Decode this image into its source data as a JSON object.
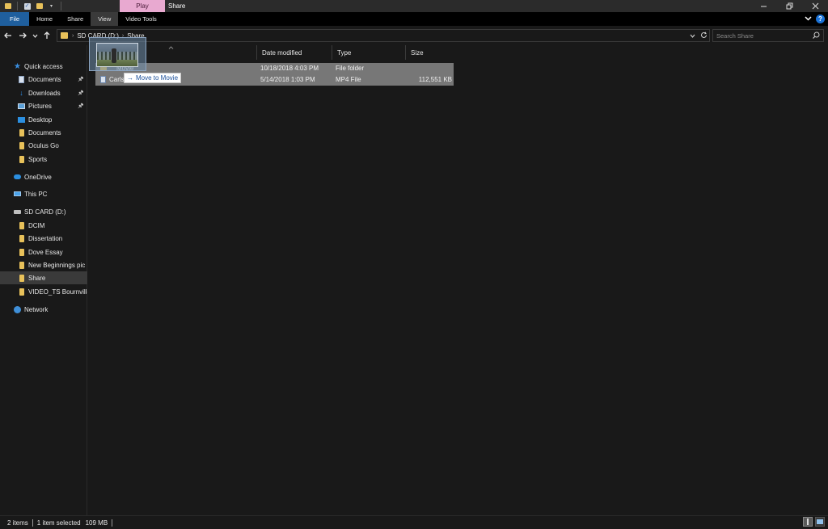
{
  "titlebar": {
    "contextual_tab": "Play",
    "title": "Share",
    "controls": [
      "minimize",
      "restore",
      "close"
    ]
  },
  "ribbon": {
    "tabs": [
      "File",
      "Home",
      "Share",
      "View",
      "Video Tools"
    ]
  },
  "address": {
    "crumbs": [
      "SD CARD (D:)",
      "Share"
    ],
    "search_placeholder": "Search Share"
  },
  "sidebar": {
    "items": [
      {
        "label": "Quick access",
        "icon": "star-icon",
        "indent": 0,
        "pinned": false
      },
      {
        "label": "Documents",
        "icon": "document-icon",
        "indent": 1,
        "pinned": true
      },
      {
        "label": "Downloads",
        "icon": "download-icon",
        "indent": 1,
        "pinned": true
      },
      {
        "label": "Pictures",
        "icon": "pictures-icon",
        "indent": 1,
        "pinned": true
      },
      {
        "label": "Desktop",
        "icon": "desktop-icon",
        "indent": 1,
        "pinned": false
      },
      {
        "label": "Documents",
        "icon": "folder-icon",
        "indent": 1,
        "pinned": false
      },
      {
        "label": "Oculus Go",
        "icon": "folder-icon",
        "indent": 1,
        "pinned": false
      },
      {
        "label": "Sports",
        "icon": "folder-icon",
        "indent": 1,
        "pinned": false
      },
      {
        "label": "OneDrive",
        "icon": "cloud-icon",
        "indent": 0,
        "pinned": false
      },
      {
        "label": "This PC",
        "icon": "computer-icon",
        "indent": 0,
        "pinned": false
      },
      {
        "label": "SD CARD (D:)",
        "icon": "drive-icon",
        "indent": 0,
        "pinned": false
      },
      {
        "label": "DCIM",
        "icon": "folder-icon",
        "indent": 1,
        "pinned": false
      },
      {
        "label": "Dissertation",
        "icon": "folder-icon",
        "indent": 1,
        "pinned": false
      },
      {
        "label": "Dove Essay",
        "icon": "folder-icon",
        "indent": 1,
        "pinned": false
      },
      {
        "label": "New Beginnings pic",
        "icon": "folder-icon",
        "indent": 1,
        "pinned": false
      },
      {
        "label": "Share",
        "icon": "folder-icon",
        "indent": 1,
        "pinned": false,
        "selected": true
      },
      {
        "label": "VIDEO_TS Bournville",
        "icon": "folder-icon",
        "indent": 1,
        "pinned": false
      },
      {
        "label": "Network",
        "icon": "network-icon",
        "indent": 0,
        "pinned": false
      }
    ]
  },
  "file_list": {
    "columns": [
      "Date modified",
      "Type",
      "Size"
    ],
    "rows": [
      {
        "name": "Movie",
        "date": "10/18/2018 4:03 PM",
        "type": "File folder",
        "size": "",
        "icon": "folder-icon"
      },
      {
        "name": "Carls",
        "date": "5/14/2018 1:03 PM",
        "type": "MP4 File",
        "size": "112,551 KB",
        "icon": "video-file-icon"
      }
    ]
  },
  "drag": {
    "tooltip": "Move to Movie"
  },
  "status": {
    "items_count": "2 items",
    "selected": "1 item selected",
    "size": "109 MB"
  }
}
